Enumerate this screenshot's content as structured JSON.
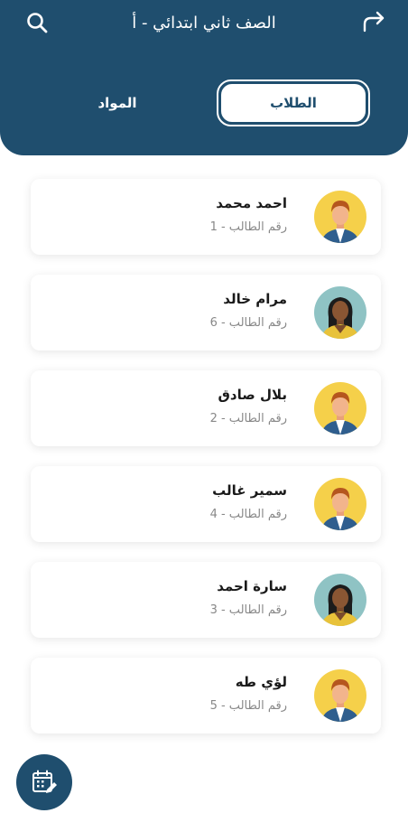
{
  "header": {
    "title": "الصف ثاني ابتدائي - أ",
    "search_icon": "search-icon",
    "forward_icon": "forward-arrow-icon"
  },
  "tabs": {
    "students": "الطلاب",
    "subjects": "المواد"
  },
  "students": [
    {
      "name": "احمد محمد",
      "number": "رقم الطالب - 1",
      "avatar": "male-avatar"
    },
    {
      "name": "مرام خالد",
      "number": "رقم الطالب - 6",
      "avatar": "female-avatar"
    },
    {
      "name": "بلال صادق",
      "number": "رقم الطالب - 2",
      "avatar": "male-avatar"
    },
    {
      "name": "سمير غالب",
      "number": "رقم الطالب - 4",
      "avatar": "male-avatar"
    },
    {
      "name": "سارة احمد",
      "number": "رقم الطالب - 3",
      "avatar": "female-avatar"
    },
    {
      "name": "لؤي طه",
      "number": "رقم الطالب - 5",
      "avatar": "male-avatar"
    }
  ],
  "fab": {
    "icon": "calendar-edit-icon"
  },
  "colors": {
    "primary": "#1f4e6e",
    "male_avatar_bg": "#f5d04a",
    "female_avatar_bg": "#8fc3c4"
  }
}
